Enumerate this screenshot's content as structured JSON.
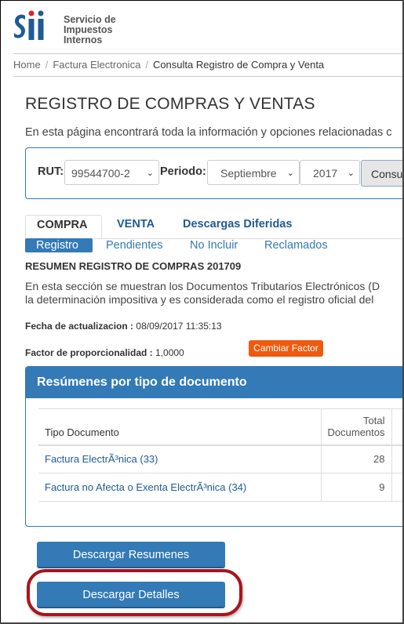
{
  "brand": {
    "logo_alt": "SII logo",
    "line1": "Servicio de",
    "line2": "Impuestos",
    "line3": "Internos",
    "colors": {
      "blue": "#1f5b96",
      "red": "#d9232e"
    }
  },
  "breadcrumb": [
    "Home",
    "Factura Electronica",
    "Consulta Registro de Compra y Venta"
  ],
  "page": {
    "title": "REGISTRO DE COMPRAS Y VENTAS",
    "intro": "En esta página encontrará toda la información y opciones relacionadas c"
  },
  "filters": {
    "rut_label": "RUT:",
    "rut_value": "99544700-2",
    "periodo_label": "Periodo:",
    "month_value": "Septiembre",
    "year_value": "2017",
    "consult_label": "Consu"
  },
  "tabs": {
    "compra": "COMPRA",
    "venta": "VENTA",
    "descargas": "Descargas Diferidas"
  },
  "subtabs": {
    "registro": "Registro",
    "pendientes": "Pendientes",
    "no_incluir": "No Incluir",
    "reclamados": "Reclamados"
  },
  "resumen": {
    "title": "RESUMEN REGISTRO DE COMPRAS 201709",
    "desc_line1": "En esta sección se muestran los Documentos Tributarios Electrónicos (D",
    "desc_line2": "la determinación impositiva y es considerada como el registro oficial del",
    "fecha_label": "Fecha de actualizacion :",
    "fecha_value": "08/09/2017 11:35:13",
    "factor_label": "Factor de proporcionalidad :",
    "factor_value": "1,0000",
    "cambiar_factor": "Cambiar Factor"
  },
  "panel": {
    "title": "Resúmenes por tipo de documento",
    "col_tipo": "Tipo Documento",
    "col_total_1": "Total",
    "col_total_2": "Documentos",
    "rows": [
      {
        "tipo": "Factura ElectrÃ³nica (33)",
        "total": "28"
      },
      {
        "tipo": "Factura no Afecta o Exenta ElectrÃ³nica (34)",
        "total": "9"
      }
    ]
  },
  "buttons": {
    "descargar_resumenes": "Descargar Resumenes",
    "descargar_detalles": "Descargar Detalles"
  },
  "accent": {
    "primary": "#337ab7",
    "orange": "#ef5a0d",
    "highlight": "#a8141d"
  }
}
